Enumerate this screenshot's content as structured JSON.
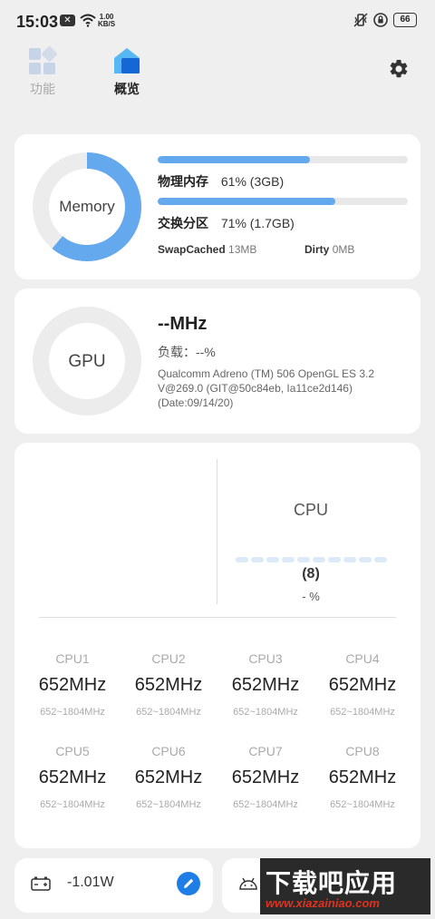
{
  "status_bar": {
    "time": "15:03",
    "notification_icon": "x-box-icon",
    "net_speed_value": "1.00",
    "net_speed_unit": "KB/S",
    "battery": "66"
  },
  "nav": {
    "functions_label": "功能",
    "overview_label": "概览",
    "active": "overview"
  },
  "memory": {
    "ring_label": "Memory",
    "ring_percent": 61,
    "physical_label": "物理内存",
    "physical_value": "61% (3GB)",
    "physical_percent": 61,
    "swap_label": "交换分区",
    "swap_value": "71% (1.7GB)",
    "swap_percent": 71,
    "swapcached_label": "SwapCached",
    "swapcached_value": "13MB",
    "dirty_label": "Dirty",
    "dirty_value": "0MB"
  },
  "gpu": {
    "ring_label": "GPU",
    "freq": "--MHz",
    "load": "负载：--%",
    "info": "Qualcomm Adreno (TM) 506 OpenGL ES 3.2 V@269.0 (GIT@50c84eb, Ia11ce2d146) (Date:09/14/20)"
  },
  "cpu": {
    "title": "CPU",
    "cores_count": "(8)",
    "load": "- %",
    "cores": [
      {
        "name": "CPU1",
        "freq": "652MHz",
        "range": "652~1804MHz"
      },
      {
        "name": "CPU2",
        "freq": "652MHz",
        "range": "652~1804MHz"
      },
      {
        "name": "CPU3",
        "freq": "652MHz",
        "range": "652~1804MHz"
      },
      {
        "name": "CPU4",
        "freq": "652MHz",
        "range": "652~1804MHz"
      },
      {
        "name": "CPU5",
        "freq": "652MHz",
        "range": "652~1804MHz"
      },
      {
        "name": "CPU6",
        "freq": "652MHz",
        "range": "652~1804MHz"
      },
      {
        "name": "CPU7",
        "freq": "652MHz",
        "range": "652~1804MHz"
      },
      {
        "name": "CPU8",
        "freq": "652MHz",
        "range": "652~1804MHz"
      }
    ]
  },
  "battery_card": {
    "power": "-1.01W"
  },
  "watermark": {
    "text": "下载吧应用",
    "url": "www.xiazainiao.com"
  },
  "colors": {
    "accent": "#64a8ee",
    "accent_dark": "#1f7ee6",
    "ring_track": "#ececec"
  }
}
